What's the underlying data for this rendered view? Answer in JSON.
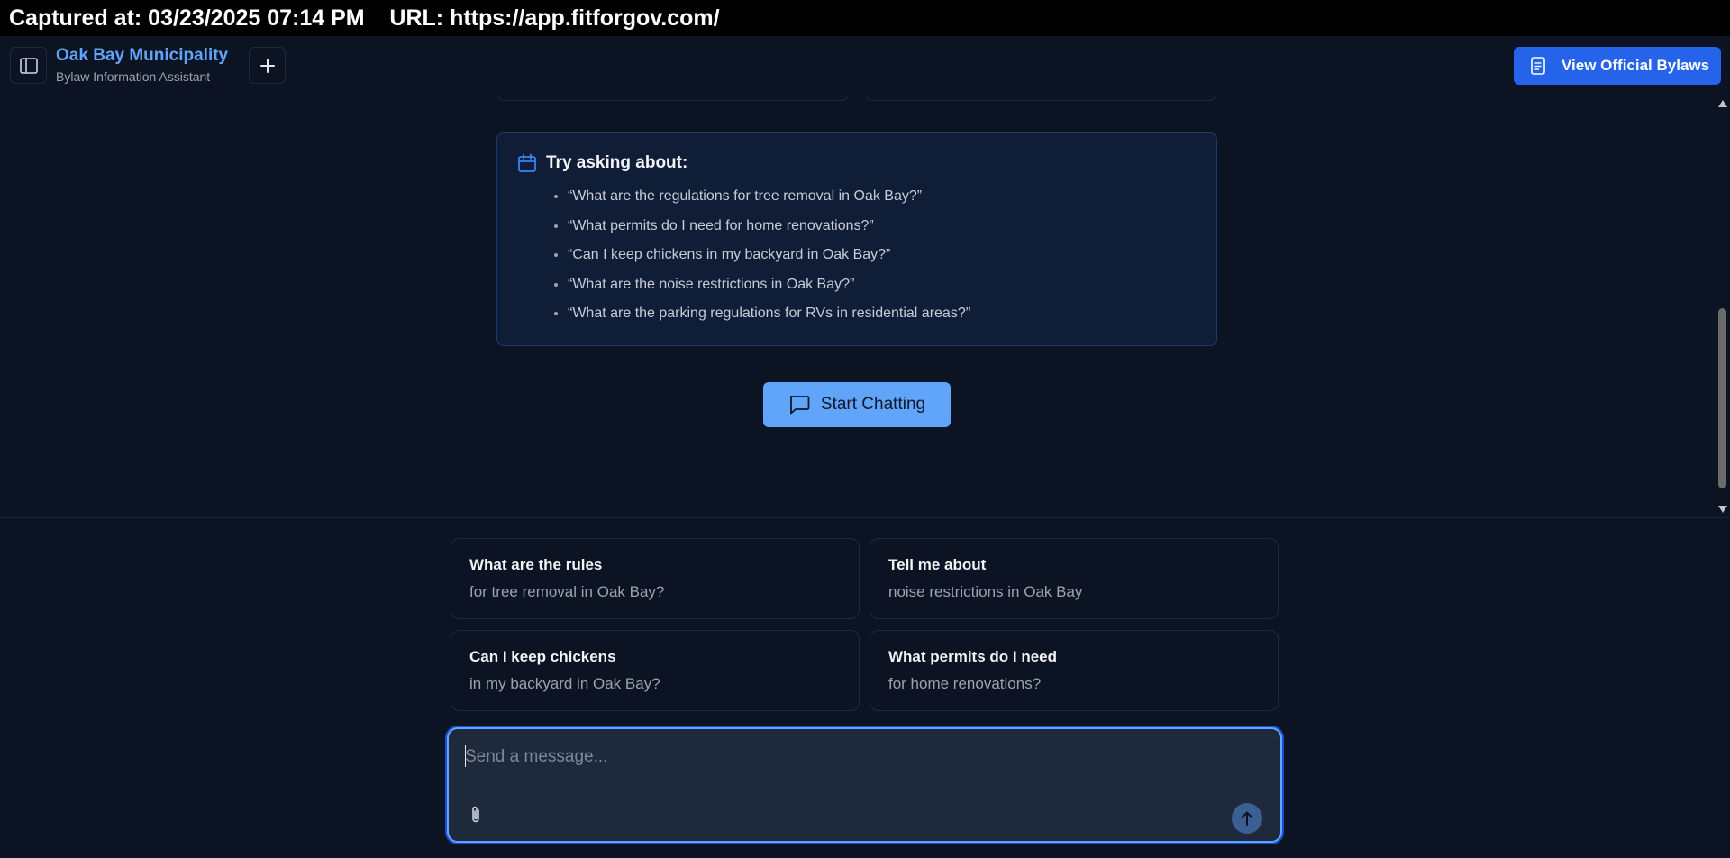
{
  "capture": {
    "text": "Captured at: 03/23/2025 07:14 PM    URL: https://app.fitforgov.com/"
  },
  "header": {
    "title": "Oak Bay Municipality",
    "subtitle": "Bylaw Information Assistant",
    "bylaws_button": "View Official Bylaws",
    "icons": [
      "sidebar-toggle-icon",
      "plus-icon",
      "document-icon"
    ]
  },
  "try_asking": {
    "title": "Try asking about:",
    "icon": "calendar-icon",
    "items": [
      "“What are the regulations for tree removal in Oak Bay?”",
      "“What permits do I need for home renovations?”",
      "“Can I keep chickens in my backyard in Oak Bay?”",
      "“What are the noise restrictions in Oak Bay?”",
      "“What are the parking regulations for RVs in residential areas?”"
    ]
  },
  "start_button": {
    "label": "Start Chatting",
    "icon": "chat-icon"
  },
  "suggestions": [
    {
      "title": "What are the rules",
      "subtitle": "for tree removal in Oak Bay?"
    },
    {
      "title": "Tell me about",
      "subtitle": "noise restrictions in Oak Bay"
    },
    {
      "title": "Can I keep chickens",
      "subtitle": "in my backyard in Oak Bay?"
    },
    {
      "title": "What permits do I need",
      "subtitle": "for home renovations?"
    }
  ],
  "composer": {
    "placeholder": "Send a message...",
    "value": "",
    "icons": [
      "paperclip-icon",
      "arrow-up-icon"
    ]
  },
  "colors": {
    "background": "#0c1424",
    "accent": "#60a5fa",
    "primary_button": "#2563eb"
  }
}
